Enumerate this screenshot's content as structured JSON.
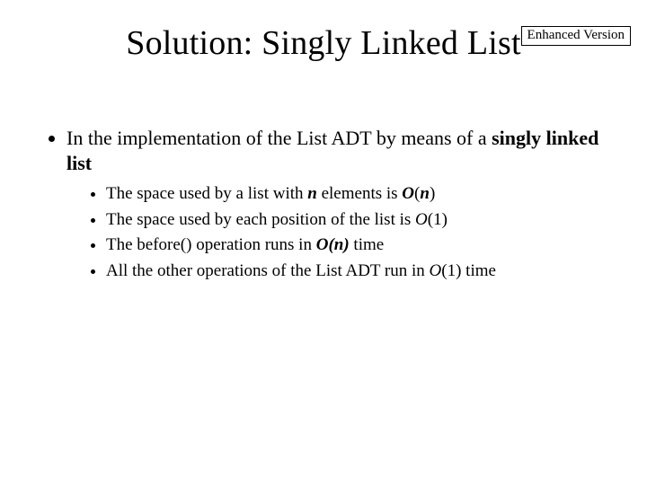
{
  "badge": "Enhanced Version",
  "title": "Solution: Singly Linked List",
  "intro": {
    "prefix": "In the implementation of the List ADT by means of a ",
    "bold": "singly linked list"
  },
  "bullets": [
    {
      "t1": "The space used by a list with ",
      "t2": "n",
      "t3": " elements is ",
      "t4": "O",
      "t5": "(",
      "t6": "n",
      "t7": ")",
      "kind": "space_n"
    },
    {
      "t1": "The space used by each position of the list is ",
      "t2": "O",
      "t3": "(1)",
      "kind": "space_1"
    },
    {
      "t1": "The before() operation runs in ",
      "t2": "O(n)",
      "t3": " time",
      "kind": "before"
    },
    {
      "t1": "All the other operations of the List ADT run in ",
      "t2": "O",
      "t3": "(1) time",
      "kind": "other"
    }
  ]
}
